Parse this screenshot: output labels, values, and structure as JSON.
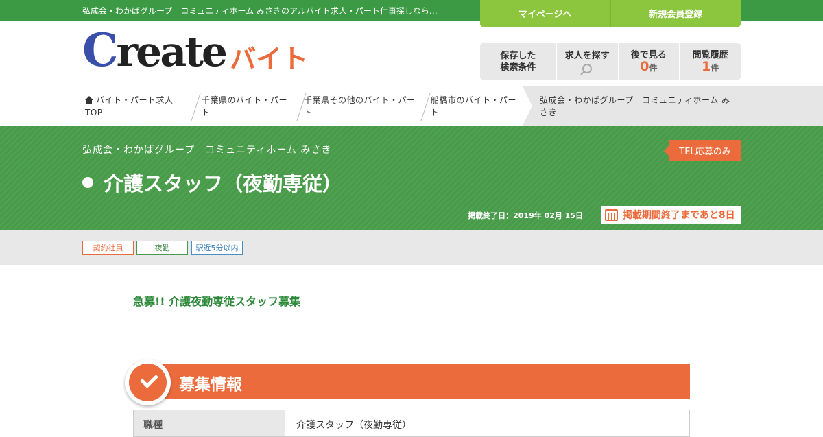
{
  "topbar": {
    "tagline": "弘成会・わかばグループ　コミュニティホーム みさきのアルバイト求人・パート仕事探しなら…",
    "mypage": "マイページへ",
    "register": "新規会員登録"
  },
  "logo": {
    "create_c": "C",
    "create_rest": "reate",
    "baito": "バイト"
  },
  "tools": {
    "saved_line1": "保存した",
    "saved_line2": "検索条件",
    "search": "求人を探す",
    "later": "後で見る",
    "later_count": "0",
    "history": "閲覧履歴",
    "history_count": "1",
    "unit": "件"
  },
  "breadcrumb": [
    "バイト・パート求人TOP",
    "千葉県のバイト・パート",
    "千葉県その他のバイト・パート",
    "船橋市のバイト・パート",
    "弘成会・わかばグループ　コミュニティホーム みさき"
  ],
  "hero": {
    "company": "弘成会・わかばグループ　コミュニティホーム みさき",
    "job_title": "介護スタッフ（夜勤専従）",
    "tel_badge": "TEL応募のみ",
    "end_date": "掲載終了日：2019年 02月 15日",
    "remaining": "掲載期間終了まであと8日"
  },
  "tags": [
    "契約社員",
    "夜勤",
    "駅近5分以内"
  ],
  "content": {
    "catch": "急募!! 介護夜勤専従スタッフ募集",
    "section_title": "募集情報",
    "table": [
      {
        "label": "職種",
        "value": "介護スタッフ（夜勤専従）"
      }
    ]
  },
  "colors": {
    "brand_green": "#3c9a45",
    "accent_orange": "#ec6b3c",
    "lime": "#8cc63f",
    "logo_blue": "#3a4fa9"
  }
}
